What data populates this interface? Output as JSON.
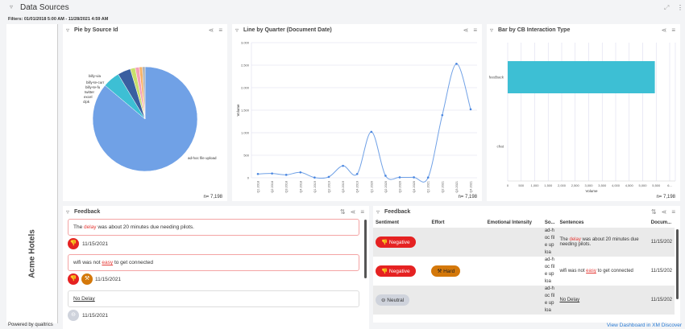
{
  "header": {
    "title": "Data Sources",
    "filters": "Filters: 01/01/2018 5:00 AM - 11/28/2021 4:59 AM",
    "expand_icon": "expand-icon",
    "more_icon": "more-icon"
  },
  "sidebar": {
    "brand": "Acme Hotels"
  },
  "footer": {
    "powered": "Powered by qualtrics",
    "link": "View Dashboard in XM Discover"
  },
  "pie": {
    "title": "Pie by Source Id",
    "n": "n= 7,198"
  },
  "line": {
    "title": "Line by Quarter (Document Date)",
    "n": "n= 7,198"
  },
  "bar": {
    "title": "Bar by CB Interaction Type",
    "n": "n= 7,198"
  },
  "chart_data": [
    {
      "type": "pie",
      "title": "Pie by Source Id",
      "labels": [
        "ad-hoc file upload",
        "clpk",
        "excel",
        "twitter",
        "billy-te-fu",
        "billy-te-curr",
        "billy-via"
      ],
      "values": [
        6200,
        380,
        290,
        110,
        90,
        70,
        58
      ],
      "colors": [
        "#70a1e6",
        "#3dbfd4",
        "#3a5fa0",
        "#c9df6b",
        "#f4a0b8",
        "#f7b267",
        "#b0b0b0"
      ]
    },
    {
      "type": "line",
      "title": "Line by Quarter (Document Date)",
      "ylabel": "Volume",
      "ylim": [
        0,
        3000
      ],
      "yticks": [
        "0",
        "500",
        "1,000",
        "1,500",
        "2,000",
        "2,500",
        "3,000"
      ],
      "categories": [
        "Q1 2018",
        "Q2 2018",
        "Q3 2018",
        "Q4 2018",
        "Q1 2019",
        "Q2 2019",
        "Q3 2019",
        "Q4 2019",
        "Q1 2020",
        "Q2 2020",
        "Q3 2020",
        "Q4 2020",
        "Q1 2021",
        "Q2 2021",
        "Q3 2021",
        "Q4 2021"
      ],
      "values": [
        85,
        95,
        65,
        120,
        5,
        20,
        265,
        85,
        1020,
        45,
        10,
        10,
        5,
        1390,
        2530,
        1520
      ]
    },
    {
      "type": "bar",
      "orientation": "horizontal",
      "title": "Bar by CB Interaction Type",
      "xlabel": "Volume",
      "xlim": [
        0,
        6000
      ],
      "xticks": [
        "0",
        "500",
        "1,000",
        "1,500",
        "2,000",
        "2,500",
        "3,000",
        "3,500",
        "4,000",
        "4,500",
        "5,000",
        "5,500",
        "6..."
      ],
      "categories": [
        "feedback",
        "chat"
      ],
      "values": [
        5450,
        0
      ],
      "color": "#3dbfd4"
    }
  ],
  "feedback_left": {
    "title": "Feedback",
    "items": [
      {
        "pre": "The ",
        "hl": "delay",
        "post": " was about 20 minutes due needing pilots.",
        "date": "11/15/2021"
      },
      {
        "pre": "wifi was not ",
        "hl": "easy",
        "post": " to get connected",
        "date": "11/15/2021"
      },
      {
        "pre": "",
        "hl": "",
        "post": "No Delay",
        "date": "11/15/2021"
      }
    ]
  },
  "feedback_table": {
    "title": "Feedback",
    "columns": [
      "Sentiment",
      "Effort",
      "Emotional Intensity",
      "So...",
      "Sentences",
      "Docum..."
    ],
    "rows": [
      {
        "sentiment": "Negative",
        "effort": "",
        "source": "ad-hoc file uploa",
        "pre": "The ",
        "hl": "delay",
        "post": " was about 20 minutes due needing pilots.",
        "date": "11/15/202"
      },
      {
        "sentiment": "Negative",
        "effort": "Hard",
        "source": "ad-hoc file uploa",
        "pre": "wifi was not ",
        "hl": "easy",
        "post": " to get connected",
        "date": "11/15/202"
      },
      {
        "sentiment": "Neutral",
        "effort": "",
        "source": "ad-hoc file uploa",
        "pre": "",
        "hl": "",
        "post": "No Delay",
        "date": "11/15/202"
      }
    ]
  }
}
